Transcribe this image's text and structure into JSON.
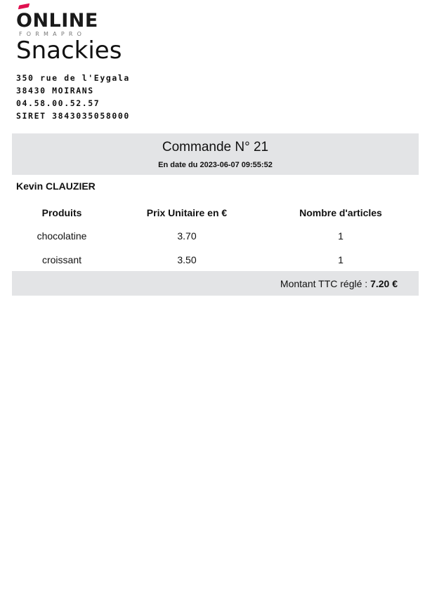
{
  "logo": {
    "word": "ONLINE",
    "subtitle": "FORMAPRO",
    "accent_color": "#e0104f"
  },
  "shop": {
    "name": "Snackies",
    "address_lines": [
      "350 rue de l'Eygala",
      "38430 MOIRANS",
      "04.58.00.52.57",
      "SIRET 3843035058000"
    ]
  },
  "order": {
    "title": "Commande N° 21",
    "date_line": "En date du 2023-06-07 09:55:52",
    "band_color": "#e3e4e6"
  },
  "customer": {
    "name": "Kevin CLAUZIER"
  },
  "table": {
    "headers": [
      "Produits",
      "Prix Unitaire en €",
      "Nombre d'articles"
    ],
    "rows": [
      [
        "chocolatine",
        "3.70",
        "1"
      ],
      [
        "croissant",
        "3.50",
        "1"
      ]
    ]
  },
  "total": {
    "label": "Montant TTC réglé : ",
    "amount": "7.20 €"
  }
}
